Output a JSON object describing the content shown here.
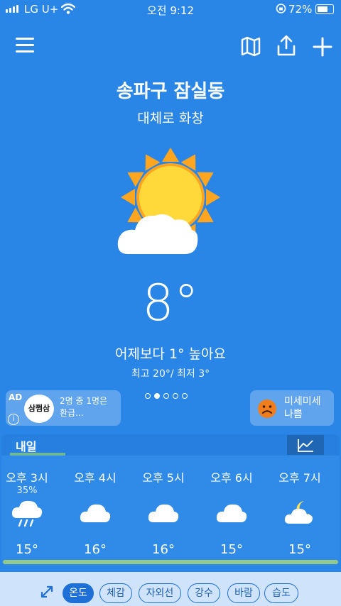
{
  "status": {
    "carrier": "LG U+",
    "time": "오전 9:12",
    "battery": "72%",
    "battery_level": 0.72
  },
  "header": {
    "menu_icon": "menu-icon",
    "map_icon": "map-icon",
    "share_icon": "share-icon",
    "add_icon": "plus-icon"
  },
  "location": "송파구 잠실동",
  "condition": "대체로 화창",
  "temperature": "8°",
  "compare": "어제보다 1° 높아요",
  "hilo": "최고 20°/ 최저 3°",
  "ad": {
    "tag": "AD",
    "logo_text": "삼쩜삼",
    "line1": "2명 중 1명은",
    "line2": "환급..."
  },
  "page_dots": {
    "count": 5,
    "active": 1
  },
  "dust": {
    "line1": "미세미세",
    "line2": "나쁨",
    "icon": "sad-face-icon",
    "color": "#f07d1e"
  },
  "forecast": {
    "day": "내일",
    "hours": [
      {
        "time": "오후 3시",
        "precip": "35%",
        "icon": "rain-cloud-icon",
        "temp": "15°"
      },
      {
        "time": "오후 4시",
        "precip": "",
        "icon": "cloud-icon",
        "temp": "16°"
      },
      {
        "time": "오후 5시",
        "precip": "",
        "icon": "cloud-icon",
        "temp": "16°"
      },
      {
        "time": "오후 6시",
        "precip": "",
        "icon": "cloud-icon",
        "temp": "15°"
      },
      {
        "time": "오후 7시",
        "precip": "",
        "icon": "moon-cloud-icon",
        "temp": "15°"
      }
    ]
  },
  "tabs": [
    "온도",
    "체감",
    "자외선",
    "강수",
    "바람",
    "습도"
  ],
  "active_tab": 0,
  "colors": {
    "background": "#2a86e6",
    "tab_accent": "#1e6fd6",
    "sun": "#ffd83a",
    "sun_rays": "#ffa51f"
  }
}
